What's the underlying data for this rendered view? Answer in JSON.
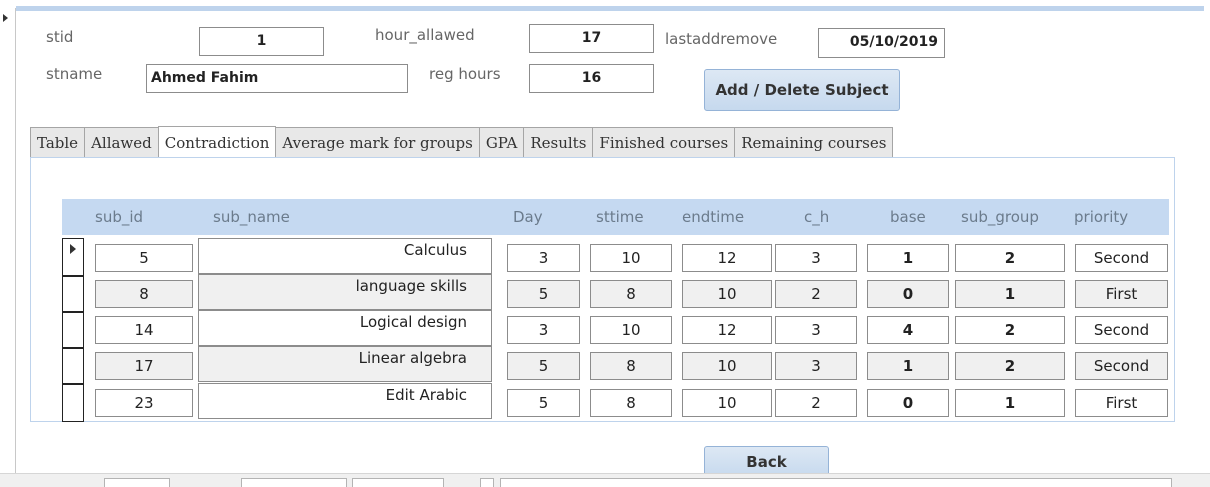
{
  "form": {
    "stid_label": "stid",
    "stid_value": "1",
    "stname_label": "stname",
    "stname_value": "Ahmed Fahim",
    "hour_allawed_label": "hour_allawed",
    "hour_allawed_value": "17",
    "reg_hours_label": "reg hours",
    "reg_hours_value": "16",
    "lastaddremove_label": "lastaddremove",
    "lastaddremove_value": "05/10/2019",
    "add_delete_label": "Add / Delete Subject",
    "back_label": "Back"
  },
  "tabs": [
    {
      "label": "Table",
      "active": false
    },
    {
      "label": "Allawed",
      "active": false
    },
    {
      "label": "Contradiction",
      "active": true
    },
    {
      "label": "Average mark for groups",
      "active": false
    },
    {
      "label": "GPA",
      "active": false
    },
    {
      "label": "Results",
      "active": false
    },
    {
      "label": "Finished courses",
      "active": false
    },
    {
      "label": "Remaining courses",
      "active": false
    }
  ],
  "table": {
    "columns": [
      "sub_id",
      "sub_name",
      "Day",
      "sttime",
      "endtime",
      "c_h",
      "base",
      "sub_group",
      "priority"
    ],
    "rows": [
      {
        "sub_id": "5",
        "sub_name": "Calculus",
        "day": "3",
        "sttime": "10",
        "endtime": "12",
        "c_h": "3",
        "base": "1",
        "sub_group": "2",
        "priority": "Second"
      },
      {
        "sub_id": "8",
        "sub_name": "language skills",
        "day": "5",
        "sttime": "8",
        "endtime": "10",
        "c_h": "2",
        "base": "0",
        "sub_group": "1",
        "priority": "First"
      },
      {
        "sub_id": "14",
        "sub_name": "Logical design",
        "day": "3",
        "sttime": "10",
        "endtime": "12",
        "c_h": "3",
        "base": "4",
        "sub_group": "2",
        "priority": "Second"
      },
      {
        "sub_id": "17",
        "sub_name": "Linear algebra",
        "day": "5",
        "sttime": "8",
        "endtime": "10",
        "c_h": "3",
        "base": "1",
        "sub_group": "2",
        "priority": "Second"
      },
      {
        "sub_id": "23",
        "sub_name": "Edit Arabic",
        "day": "5",
        "sttime": "8",
        "endtime": "10",
        "c_h": "2",
        "base": "0",
        "sub_group": "1",
        "priority": "First"
      }
    ]
  },
  "colors": {
    "header_bg": "#c5d9f1",
    "accent": "#bed3ec",
    "button": "#c6d9ee"
  }
}
